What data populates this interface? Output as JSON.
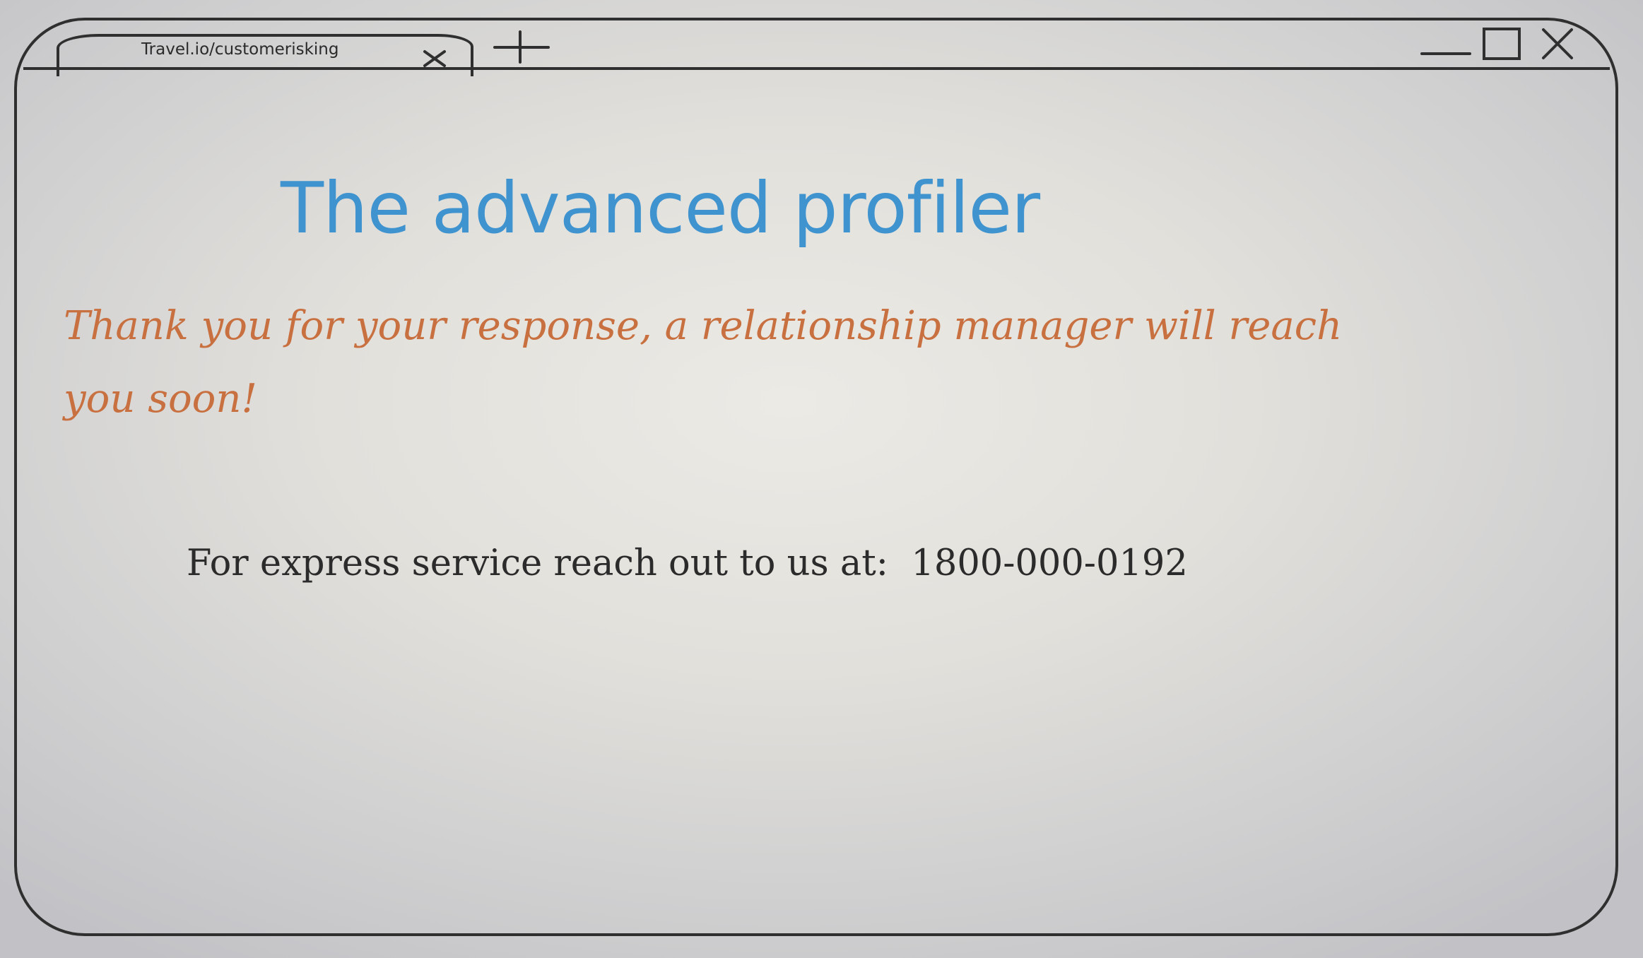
{
  "browser": {
    "tab": {
      "url": "Travel.io/customerisking",
      "close_icon": "close-x-icon"
    },
    "new_tab_icon": "plus-icon",
    "window_controls": [
      "minimize-icon",
      "maximize-icon",
      "close-icon"
    ]
  },
  "page": {
    "title": "The advanced profiler",
    "message": "Thank you for your response, a relationship manager will reach you soon!",
    "contact_prefix": "For express service reach out to us at:",
    "phone": "1800-000-0192"
  },
  "colors": {
    "title": "#3f93cf",
    "message": "#c8703f",
    "outline": "#2f2f2f",
    "text": "#2b2b2b"
  }
}
